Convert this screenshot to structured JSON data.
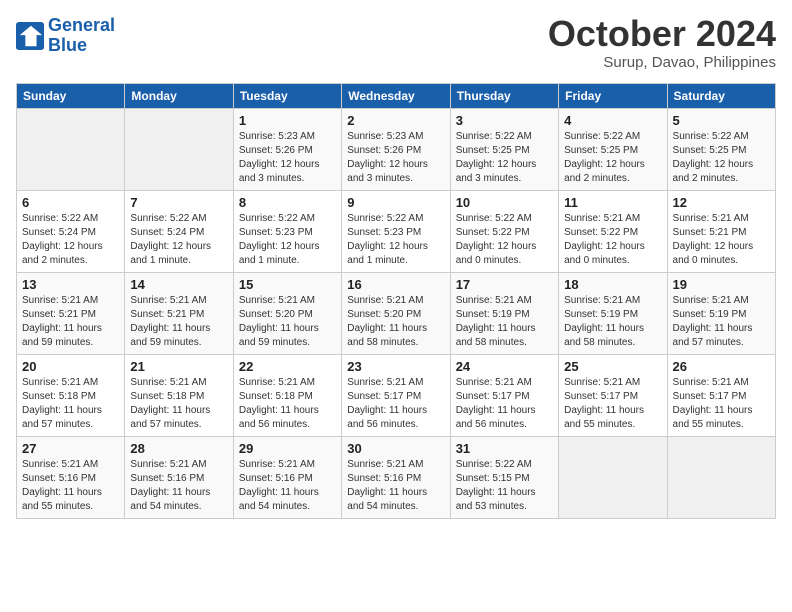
{
  "logo": {
    "line1": "General",
    "line2": "Blue"
  },
  "title": "October 2024",
  "location": "Surup, Davao, Philippines",
  "weekdays": [
    "Sunday",
    "Monday",
    "Tuesday",
    "Wednesday",
    "Thursday",
    "Friday",
    "Saturday"
  ],
  "weeks": [
    [
      {
        "day": "",
        "info": ""
      },
      {
        "day": "",
        "info": ""
      },
      {
        "day": "1",
        "info": "Sunrise: 5:23 AM\nSunset: 5:26 PM\nDaylight: 12 hours\nand 3 minutes."
      },
      {
        "day": "2",
        "info": "Sunrise: 5:23 AM\nSunset: 5:26 PM\nDaylight: 12 hours\nand 3 minutes."
      },
      {
        "day": "3",
        "info": "Sunrise: 5:22 AM\nSunset: 5:25 PM\nDaylight: 12 hours\nand 3 minutes."
      },
      {
        "day": "4",
        "info": "Sunrise: 5:22 AM\nSunset: 5:25 PM\nDaylight: 12 hours\nand 2 minutes."
      },
      {
        "day": "5",
        "info": "Sunrise: 5:22 AM\nSunset: 5:25 PM\nDaylight: 12 hours\nand 2 minutes."
      }
    ],
    [
      {
        "day": "6",
        "info": "Sunrise: 5:22 AM\nSunset: 5:24 PM\nDaylight: 12 hours\nand 2 minutes."
      },
      {
        "day": "7",
        "info": "Sunrise: 5:22 AM\nSunset: 5:24 PM\nDaylight: 12 hours\nand 1 minute."
      },
      {
        "day": "8",
        "info": "Sunrise: 5:22 AM\nSunset: 5:23 PM\nDaylight: 12 hours\nand 1 minute."
      },
      {
        "day": "9",
        "info": "Sunrise: 5:22 AM\nSunset: 5:23 PM\nDaylight: 12 hours\nand 1 minute."
      },
      {
        "day": "10",
        "info": "Sunrise: 5:22 AM\nSunset: 5:22 PM\nDaylight: 12 hours\nand 0 minutes."
      },
      {
        "day": "11",
        "info": "Sunrise: 5:21 AM\nSunset: 5:22 PM\nDaylight: 12 hours\nand 0 minutes."
      },
      {
        "day": "12",
        "info": "Sunrise: 5:21 AM\nSunset: 5:21 PM\nDaylight: 12 hours\nand 0 minutes."
      }
    ],
    [
      {
        "day": "13",
        "info": "Sunrise: 5:21 AM\nSunset: 5:21 PM\nDaylight: 11 hours\nand 59 minutes."
      },
      {
        "day": "14",
        "info": "Sunrise: 5:21 AM\nSunset: 5:21 PM\nDaylight: 11 hours\nand 59 minutes."
      },
      {
        "day": "15",
        "info": "Sunrise: 5:21 AM\nSunset: 5:20 PM\nDaylight: 11 hours\nand 59 minutes."
      },
      {
        "day": "16",
        "info": "Sunrise: 5:21 AM\nSunset: 5:20 PM\nDaylight: 11 hours\nand 58 minutes."
      },
      {
        "day": "17",
        "info": "Sunrise: 5:21 AM\nSunset: 5:19 PM\nDaylight: 11 hours\nand 58 minutes."
      },
      {
        "day": "18",
        "info": "Sunrise: 5:21 AM\nSunset: 5:19 PM\nDaylight: 11 hours\nand 58 minutes."
      },
      {
        "day": "19",
        "info": "Sunrise: 5:21 AM\nSunset: 5:19 PM\nDaylight: 11 hours\nand 57 minutes."
      }
    ],
    [
      {
        "day": "20",
        "info": "Sunrise: 5:21 AM\nSunset: 5:18 PM\nDaylight: 11 hours\nand 57 minutes."
      },
      {
        "day": "21",
        "info": "Sunrise: 5:21 AM\nSunset: 5:18 PM\nDaylight: 11 hours\nand 57 minutes."
      },
      {
        "day": "22",
        "info": "Sunrise: 5:21 AM\nSunset: 5:18 PM\nDaylight: 11 hours\nand 56 minutes."
      },
      {
        "day": "23",
        "info": "Sunrise: 5:21 AM\nSunset: 5:17 PM\nDaylight: 11 hours\nand 56 minutes."
      },
      {
        "day": "24",
        "info": "Sunrise: 5:21 AM\nSunset: 5:17 PM\nDaylight: 11 hours\nand 56 minutes."
      },
      {
        "day": "25",
        "info": "Sunrise: 5:21 AM\nSunset: 5:17 PM\nDaylight: 11 hours\nand 55 minutes."
      },
      {
        "day": "26",
        "info": "Sunrise: 5:21 AM\nSunset: 5:17 PM\nDaylight: 11 hours\nand 55 minutes."
      }
    ],
    [
      {
        "day": "27",
        "info": "Sunrise: 5:21 AM\nSunset: 5:16 PM\nDaylight: 11 hours\nand 55 minutes."
      },
      {
        "day": "28",
        "info": "Sunrise: 5:21 AM\nSunset: 5:16 PM\nDaylight: 11 hours\nand 54 minutes."
      },
      {
        "day": "29",
        "info": "Sunrise: 5:21 AM\nSunset: 5:16 PM\nDaylight: 11 hours\nand 54 minutes."
      },
      {
        "day": "30",
        "info": "Sunrise: 5:21 AM\nSunset: 5:16 PM\nDaylight: 11 hours\nand 54 minutes."
      },
      {
        "day": "31",
        "info": "Sunrise: 5:22 AM\nSunset: 5:15 PM\nDaylight: 11 hours\nand 53 minutes."
      },
      {
        "day": "",
        "info": ""
      },
      {
        "day": "",
        "info": ""
      }
    ]
  ]
}
